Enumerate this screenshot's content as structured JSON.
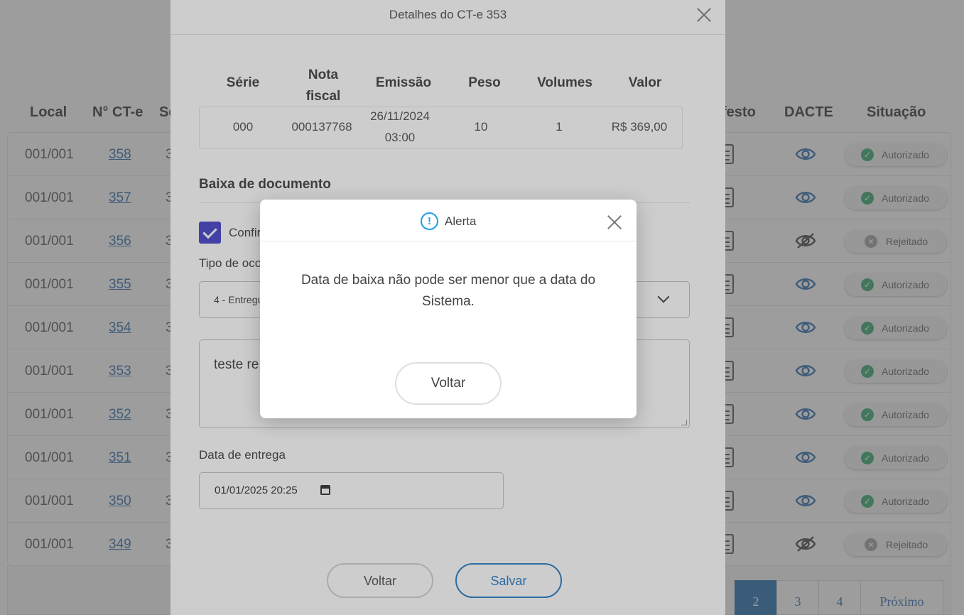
{
  "list": {
    "headers": {
      "local": "Local",
      "numero": "N° CT-e",
      "serie": "Se",
      "manifesto": "festo",
      "dacte": "DACTE",
      "situacao": "Situação"
    },
    "rows": [
      {
        "local": "001/001",
        "numero": "358",
        "serie": "3",
        "dacte_icon": "eye-icon",
        "status": "Autorizado",
        "status_type": "ok"
      },
      {
        "local": "001/001",
        "numero": "357",
        "serie": "3",
        "dacte_icon": "eye-icon",
        "status": "Autorizado",
        "status_type": "ok"
      },
      {
        "local": "001/001",
        "numero": "356",
        "serie": "3",
        "dacte_icon": "eye-off-icon",
        "status": "Rejeitado",
        "status_type": "err"
      },
      {
        "local": "001/001",
        "numero": "355",
        "serie": "3",
        "dacte_icon": "eye-icon",
        "status": "Autorizado",
        "status_type": "ok"
      },
      {
        "local": "001/001",
        "numero": "354",
        "serie": "3",
        "dacte_icon": "eye-icon",
        "status": "Autorizado",
        "status_type": "ok"
      },
      {
        "local": "001/001",
        "numero": "353",
        "serie": "3",
        "dacte_icon": "eye-icon",
        "status": "Autorizado",
        "status_type": "ok"
      },
      {
        "local": "001/001",
        "numero": "352",
        "serie": "3",
        "dacte_icon": "eye-icon",
        "status": "Autorizado",
        "status_type": "ok"
      },
      {
        "local": "001/001",
        "numero": "351",
        "serie": "3",
        "dacte_icon": "eye-icon",
        "status": "Autorizado",
        "status_type": "ok"
      },
      {
        "local": "001/001",
        "numero": "350",
        "serie": "3",
        "dacte_icon": "eye-icon",
        "status": "Autorizado",
        "status_type": "ok"
      },
      {
        "local": "001/001",
        "numero": "349",
        "serie": "3",
        "dacte_icon": "eye-off-icon",
        "status": "Rejeitado",
        "status_type": "err"
      }
    ]
  },
  "pagination": {
    "pages": [
      "2",
      "3",
      "4"
    ],
    "active": "2",
    "next": "Próximo"
  },
  "details_modal": {
    "title": "Detalhes do CT-e 353",
    "table": {
      "headers": {
        "serie": "Série",
        "nota_line1": "Nota",
        "nota_line2": "fiscal",
        "emissao": "Emissão",
        "peso": "Peso",
        "volumes": "Volumes",
        "valor": "Valor"
      },
      "row": {
        "serie": "000",
        "nota": "000137768",
        "emissao_date": "26/11/2024",
        "emissao_time": "03:00",
        "peso": "10",
        "volumes": "1",
        "valor": "R$ 369,00"
      }
    },
    "section_title": "Baixa de documento",
    "confirm_label": "Confir",
    "ocorrencia_label": "Tipo de oco",
    "ocorrencia_value": "4 - Entregu",
    "observacao_value": "teste re",
    "data_label": "Data de entrega",
    "data_value": "01/01/2025  20:25",
    "voltar_label": "Voltar",
    "salvar_label": "Salvar"
  },
  "alert": {
    "title": "Alerta",
    "message": "Data de baixa não pode ser menor que a data do Sistema.",
    "button_label": "Voltar"
  },
  "colors": {
    "accent": "#1a73c2",
    "active_page": "#0d5ea8",
    "ok": "#1fa463",
    "checkbox": "#3a36c7",
    "alert_icon": "#1aa0e8"
  }
}
